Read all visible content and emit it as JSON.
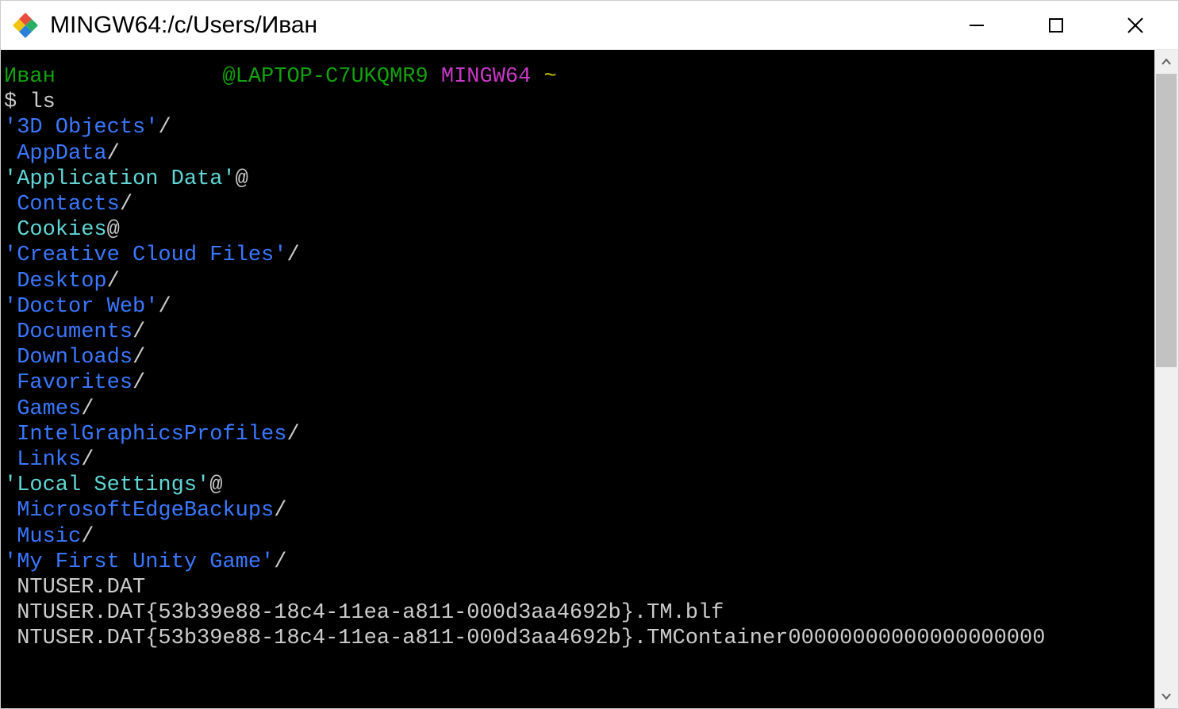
{
  "window": {
    "title": "MINGW64:/c/Users/Иван"
  },
  "prompt": {
    "user": "Иван",
    "user_pad": "             ",
    "host": "@LAPTOP-C7UKQMR9",
    "env": "MINGW64",
    "path": "~",
    "symbol": "$",
    "command": "ls"
  },
  "ls": [
    {
      "lead": "",
      "name": "'3D Objects'",
      "suffix": "/",
      "color": "blue"
    },
    {
      "lead": " ",
      "name": "AppData",
      "suffix": "/",
      "color": "blue"
    },
    {
      "lead": "",
      "name": "'Application Data'",
      "suffix": "@",
      "color": "cyan"
    },
    {
      "lead": " ",
      "name": "Contacts",
      "suffix": "/",
      "color": "blue"
    },
    {
      "lead": " ",
      "name": "Cookies",
      "suffix": "@",
      "color": "cyan"
    },
    {
      "lead": "",
      "name": "'Creative Cloud Files'",
      "suffix": "/",
      "color": "blue"
    },
    {
      "lead": " ",
      "name": "Desktop",
      "suffix": "/",
      "color": "blue"
    },
    {
      "lead": "",
      "name": "'Doctor Web'",
      "suffix": "/",
      "color": "blue"
    },
    {
      "lead": " ",
      "name": "Documents",
      "suffix": "/",
      "color": "blue"
    },
    {
      "lead": " ",
      "name": "Downloads",
      "suffix": "/",
      "color": "blue"
    },
    {
      "lead": " ",
      "name": "Favorites",
      "suffix": "/",
      "color": "blue"
    },
    {
      "lead": " ",
      "name": "Games",
      "suffix": "/",
      "color": "blue"
    },
    {
      "lead": " ",
      "name": "IntelGraphicsProfiles",
      "suffix": "/",
      "color": "blue"
    },
    {
      "lead": " ",
      "name": "Links",
      "suffix": "/",
      "color": "blue"
    },
    {
      "lead": "",
      "name": "'Local Settings'",
      "suffix": "@",
      "color": "cyan"
    },
    {
      "lead": " ",
      "name": "MicrosoftEdgeBackups",
      "suffix": "/",
      "color": "blue"
    },
    {
      "lead": " ",
      "name": "Music",
      "suffix": "/",
      "color": "blue"
    },
    {
      "lead": "",
      "name": "'My First Unity Game'",
      "suffix": "/",
      "color": "blue"
    },
    {
      "lead": " ",
      "name": "NTUSER.DAT",
      "suffix": "",
      "color": "gray"
    },
    {
      "lead": " ",
      "name": "NTUSER.DAT{53b39e88-18c4-11ea-a811-000d3aa4692b}.TM.blf",
      "suffix": "",
      "color": "gray"
    },
    {
      "lead": " ",
      "name": "NTUSER.DAT{53b39e88-18c4-11ea-a811-000d3aa4692b}.TMContainer00000000000000000000",
      "suffix": "",
      "color": "gray"
    }
  ]
}
